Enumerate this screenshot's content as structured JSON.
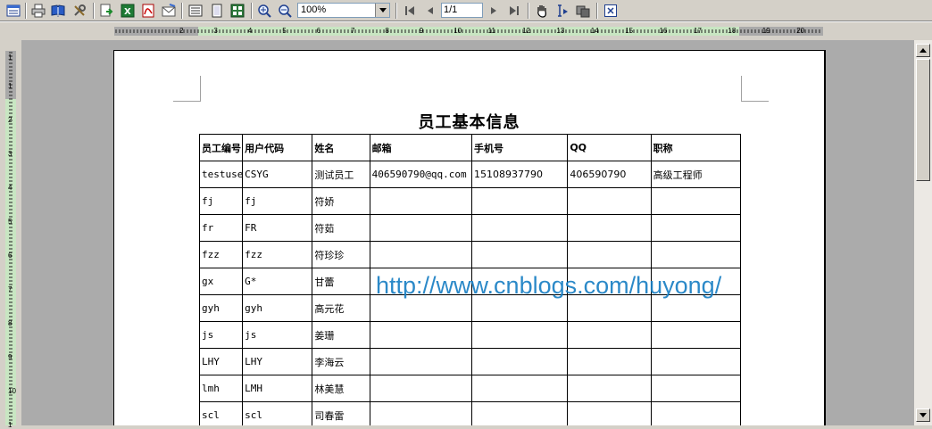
{
  "toolbar": {
    "zoom_value": "100%",
    "page_value": "1/1",
    "icons": [
      "layout-icon",
      "print-icon",
      "book-icon",
      "tools-icon",
      "export-icon",
      "excel-icon",
      "pdf-icon",
      "email-icon",
      "page-setup-icon",
      "single-page-icon",
      "multi-page-icon",
      "zoom-in-icon",
      "zoom-out-icon",
      "first-page-icon",
      "prev-page-icon",
      "next-page-icon",
      "last-page-icon",
      "hand-icon",
      "text-select-icon",
      "snapshot-icon",
      "close-icon"
    ]
  },
  "ruler": {
    "h_numbers": [
      "2",
      "3",
      "4",
      "5",
      "6",
      "7",
      "8",
      "9",
      "10",
      "11",
      "12",
      "13",
      "14",
      "15",
      "16",
      "17",
      "18",
      "19",
      "20"
    ],
    "v_numbers": [
      "1",
      "2",
      "3",
      "4",
      "5",
      "6",
      "7",
      "8",
      "9",
      "10",
      "1"
    ],
    "v_top_dash": "1"
  },
  "report": {
    "title": "员工基本信息",
    "headers": [
      "员工编号",
      "用户代码",
      "姓名",
      "邮箱",
      "手机号",
      "QQ",
      "职称"
    ],
    "rows": [
      [
        "testuser",
        "CSYG",
        "测试员工",
        "406590790@qq.com",
        "15108937790",
        "406590790",
        "高级工程师"
      ],
      [
        "fj",
        "fj",
        "符娇",
        "",
        "",
        "",
        ""
      ],
      [
        "fr",
        "FR",
        "符茹",
        "",
        "",
        "",
        ""
      ],
      [
        "fzz",
        "fzz",
        "符珍珍",
        "",
        "",
        "",
        ""
      ],
      [
        "gx",
        "G*",
        "甘蕾",
        "",
        "",
        "",
        ""
      ],
      [
        "gyh",
        "gyh",
        "高元花",
        "",
        "",
        "",
        ""
      ],
      [
        "js",
        "js",
        "姜珊",
        "",
        "",
        "",
        ""
      ],
      [
        "LHY",
        "LHY",
        "李海云",
        "",
        "",
        "",
        ""
      ],
      [
        "lmh",
        "LMH",
        "林美慧",
        "",
        "",
        "",
        ""
      ],
      [
        "scl",
        "scl",
        "司春雷",
        "",
        "",
        "",
        ""
      ]
    ],
    "watermark": "http://www.cnblogs.com/huyong/"
  },
  "colors": {
    "ruler_active": "#c8e6c2",
    "watermark": "#1a7fc4",
    "canvas": "#ababab"
  }
}
